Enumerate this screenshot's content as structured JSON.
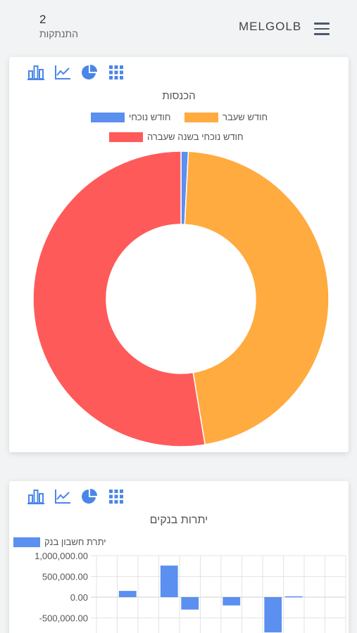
{
  "header": {
    "count": "2",
    "count_label": "התנתקות",
    "logo": "MELGOLB"
  },
  "colors": {
    "current_month": "#5b8ff0",
    "last_month": "#ffab40",
    "current_month_last_year": "#ff5a5a",
    "icon": "#4a86e8"
  },
  "icons": [
    "bar-chart-icon",
    "line-chart-icon",
    "pie-chart-icon",
    "grid-icon"
  ],
  "income_card": {
    "title": "הכנסות",
    "legend": [
      "חודש נוכחי",
      "חודש שעבר",
      "חודש נוכחי בשנה שעברה"
    ],
    "chart_data": {
      "type": "pie",
      "labels": [
        "חודש נוכחי",
        "חודש שעבר",
        "חודש נוכחי בשנה שעברה"
      ],
      "values": [
        0.8,
        46.6,
        52.6
      ],
      "unit": "percent of total (estimated)"
    }
  },
  "banks_card": {
    "title": "יתרות בנקים",
    "legend": [
      "יתרת חשבון בנק"
    ],
    "chart_data": {
      "type": "bar",
      "series": [
        {
          "name": "יתרת חשבון בנק",
          "values": [
            0,
            150000,
            0,
            760000,
            -300000,
            0,
            -200000,
            0,
            -850000,
            20000,
            0,
            0
          ]
        }
      ],
      "y_ticks": [
        "1,000,000.00",
        "500,000.00",
        "0.00",
        "-500,000.00"
      ],
      "ylim": [
        -900000,
        1000000
      ],
      "grid": true
    }
  }
}
